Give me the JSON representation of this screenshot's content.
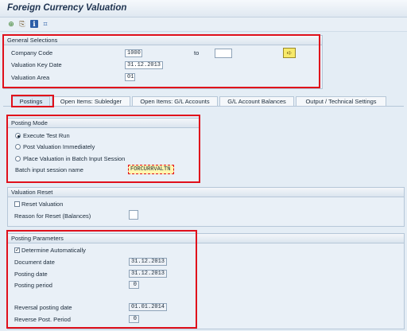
{
  "title": "Foreign Currency Valuation",
  "toolbar": {
    "icons": [
      "execute-icon",
      "variant-icon",
      "info-icon",
      "selection-options-icon"
    ],
    "glyphs": [
      "⊕",
      "⎘",
      "ℹ",
      "⌗"
    ]
  },
  "general": {
    "title": "General Selections",
    "company_code_label": "Company Code",
    "company_code": "1000",
    "to_label": "to",
    "company_code_to": "",
    "valuation_key_date_label": "Valuation Key Date",
    "valuation_key_date": "31.12.2013",
    "valuation_area_label": "Valuation Area",
    "valuation_area": "01",
    "multiple_selection_glyph": "➪"
  },
  "tabs": [
    {
      "label": "Postings"
    },
    {
      "label": "Open Items: Subledger"
    },
    {
      "label": "Open Items: G/L Accounts"
    },
    {
      "label": "G/L Account Balances"
    },
    {
      "label": "Output / Technical Settings"
    }
  ],
  "posting_mode": {
    "title": "Posting Mode",
    "options": [
      "Execute Test Run",
      "Post Valuation Immediately",
      "Place Valuation in Batch Input Session"
    ],
    "selected": 0,
    "session_label": "Batch input session name",
    "session_value": "FORCURRVALTN"
  },
  "valuation_reset": {
    "title": "Valuation Reset",
    "reset_label": "Reset Valuation",
    "reset_checked": false,
    "reason_label": "Reason for Reset (Balances)",
    "reason_value": ""
  },
  "posting_params": {
    "title": "Posting Parameters",
    "determine_label": "Determine Automatically",
    "determine_checked": true,
    "document_date_label": "Document date",
    "document_date": "31.12.2013",
    "posting_date_label": "Posting date",
    "posting_date": "31.12.2013",
    "posting_period_label": "Posting period",
    "posting_period": "0",
    "reversal_date_label": "Reversal posting date",
    "reversal_date": "01.01.2014",
    "reverse_period_label": "Reverse Post. Period",
    "reverse_period": "0"
  },
  "colors": {
    "highlight": "#e0101b",
    "background": "#e4edf5",
    "required_field": "#fff7b0"
  }
}
